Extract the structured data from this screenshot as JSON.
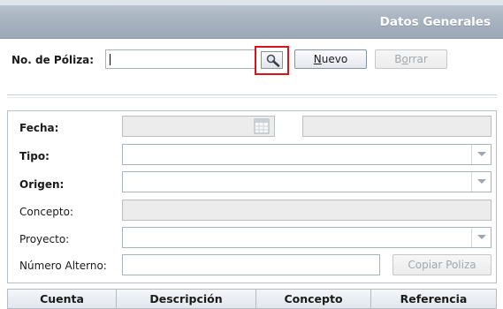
{
  "window": {
    "title": "Datos Generales"
  },
  "poliza": {
    "label": "No. de Póliza:",
    "value": "",
    "nuevo_prefix": "",
    "nuevo_underline": "N",
    "nuevo_rest": "uevo",
    "borrar_prefix": "B",
    "borrar_underline": "o",
    "borrar_rest": "rrar"
  },
  "form": {
    "fecha_label": "Fecha:",
    "fecha_value": "",
    "fecha_extra_value": "",
    "tipo_label": "Tipo:",
    "tipo_value": "",
    "origen_label": "Origen:",
    "origen_value": "",
    "concepto_label": "Concepto:",
    "concepto_value": "",
    "proyecto_label": "Proyecto:",
    "proyecto_value": "",
    "numero_alterno_label": "Número Alterno:",
    "numero_alterno_value": "",
    "copiar_label": "Copiar Poliza"
  },
  "grid": {
    "columns": [
      "Cuenta",
      "Descripción",
      "Concepto",
      "Referencia"
    ]
  },
  "icons": {
    "search": "magnifier-icon",
    "calendar": "calendar-icon",
    "dropdown": "chevron-down-icon"
  },
  "colors": {
    "highlight": "#d9121b",
    "title_text": "#ffffff"
  }
}
